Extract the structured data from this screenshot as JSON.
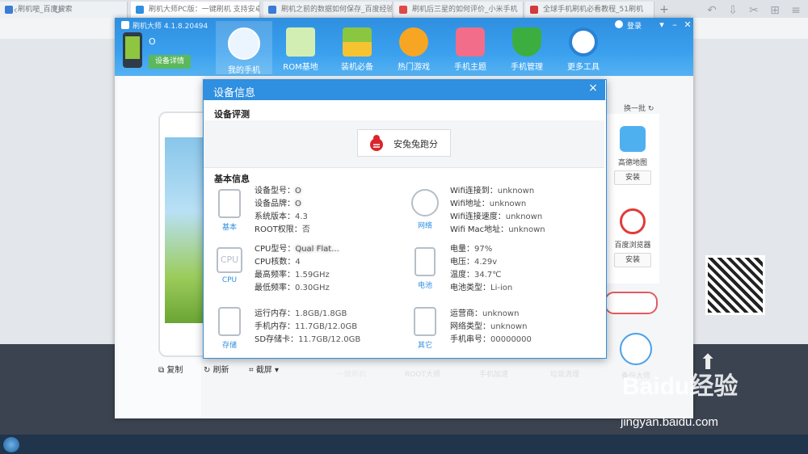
{
  "browser": {
    "tabs": [
      {
        "label": "刷机吧_百度搜索"
      },
      {
        "label": "刷机大师PC版：一键刷机 支持安卓手机"
      },
      {
        "label": "刷机之前的数据如何保存_百度经验"
      },
      {
        "label": "刷机后三星的如何评价_小米手机"
      },
      {
        "label": "全球手机刷机必看教程_51刷机"
      }
    ],
    "new_tab": "+"
  },
  "app": {
    "title": "刷机大师 4.1.8.20494",
    "login": "登录",
    "window_controls": {
      "menu": "▾",
      "minimize": "–",
      "close": "✕"
    },
    "device_name": "O",
    "device_detail_button": "设备详情",
    "nav": [
      {
        "label": "我的手机",
        "icon": "cloud-icon"
      },
      {
        "label": "ROM基地",
        "icon": "bag-icon"
      },
      {
        "label": "装机必备",
        "icon": "box-icon"
      },
      {
        "label": "热门游戏",
        "icon": "gamepad-icon"
      },
      {
        "label": "手机主题",
        "icon": "shirt-icon"
      },
      {
        "label": "手机管理",
        "icon": "shield-icon"
      },
      {
        "label": "更多工具",
        "icon": "gear-icon"
      }
    ],
    "background": {
      "swap_label": "换一批",
      "apps": [
        {
          "name": "高德地图",
          "action": "安装"
        },
        {
          "name": "百度浏览器",
          "action": "安装"
        }
      ],
      "phone_actions": [
        {
          "label": "复制"
        },
        {
          "label": "刷新"
        },
        {
          "label": "截屏"
        }
      ],
      "tools": [
        {
          "label": "一键刷机"
        },
        {
          "label": "ROOT大师"
        },
        {
          "label": "手机加速"
        },
        {
          "label": "垃圾清理"
        },
        {
          "label": "备份大师"
        }
      ]
    }
  },
  "dialog": {
    "title": "设备信息",
    "close": "×",
    "eval_section": "设备评测",
    "bench_button": "安兔兔跑分",
    "basic_section": "基本信息",
    "groups": [
      {
        "icon_label": "基本",
        "icon": "phone-icon",
        "rows": [
          {
            "k": "设备型号：",
            "v": "O"
          },
          {
            "k": "设备品牌：",
            "v": "O"
          },
          {
            "k": "系统版本：",
            "v": "4.3"
          },
          {
            "k": "ROOT权限：",
            "v": "否"
          }
        ]
      },
      {
        "icon_label": "网络",
        "icon": "wifi-icon",
        "rows": [
          {
            "k": "Wifi连接到：",
            "v": "unknown"
          },
          {
            "k": "Wifi地址：",
            "v": "unknown"
          },
          {
            "k": "Wifi连接速度：",
            "v": "unknown"
          },
          {
            "k": "Wifi Mac地址：",
            "v": "unknown"
          }
        ]
      },
      {
        "icon_label": "CPU",
        "icon": "cpu-icon",
        "rows": [
          {
            "k": "CPU型号：",
            "v": "Qual Flat..."
          },
          {
            "k": "CPU核数：",
            "v": "4"
          },
          {
            "k": "最高频率：",
            "v": "1.59GHz"
          },
          {
            "k": "最低频率：",
            "v": "0.30GHz"
          }
        ]
      },
      {
        "icon_label": "电池",
        "icon": "battery-icon",
        "rows": [
          {
            "k": "电量：",
            "v": "97%"
          },
          {
            "k": "电压：",
            "v": "4.29v"
          },
          {
            "k": "温度：",
            "v": "34.7℃"
          },
          {
            "k": "电池类型：",
            "v": "Li-ion"
          }
        ]
      },
      {
        "icon_label": "存储",
        "icon": "storage-icon",
        "rows": [
          {
            "k": "运行内存：",
            "v": "1.8GB/1.8GB"
          },
          {
            "k": "手机内存：",
            "v": "11.7GB/12.0GB"
          },
          {
            "k": "SD存储卡：",
            "v": "11.7GB/12.0GB"
          }
        ]
      },
      {
        "icon_label": "其它",
        "icon": "document-icon",
        "rows": [
          {
            "k": "运营商：",
            "v": "unknown"
          },
          {
            "k": "网络类型：",
            "v": "unknown"
          },
          {
            "k": "手机串号：",
            "v": "00000000"
          }
        ]
      }
    ]
  },
  "watermark": {
    "logo": "Baidu经验",
    "url": "jingyan.baidu.com"
  },
  "colors": {
    "accent": "#2f8fe0",
    "nav_bg": "#3aa0ee",
    "ok_green": "#5cb85c"
  }
}
